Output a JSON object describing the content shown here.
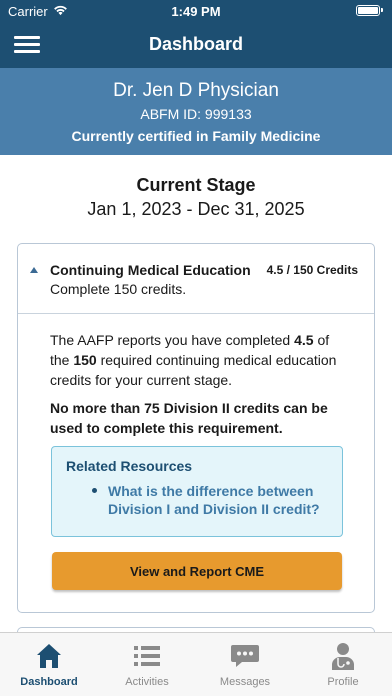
{
  "status_bar": {
    "carrier": "Carrier",
    "time": "1:49 PM"
  },
  "nav": {
    "title": "Dashboard"
  },
  "profile": {
    "name": "Dr. Jen D Physician",
    "abfm_id": "ABFM ID: 999133",
    "certification": "Currently certified in Family Medicine"
  },
  "stage": {
    "title": "Current Stage",
    "dates": "Jan 1, 2023 - Dec 31, 2025"
  },
  "cme_card": {
    "title": "Continuing Medical Education",
    "credits": "4.5 / 150 Credits",
    "subtitle": "Complete 150 credits.",
    "body_prefix": "The AAFP reports you have completed ",
    "completed": "4.5",
    "body_mid": " of the ",
    "required": "150",
    "body_suffix": " required continuing medical education credits for your current stage.",
    "note": "No more than 75 Division II credits can be used to complete this requirement.",
    "resources_title": "Related Resources",
    "resources": [
      "What is the difference between Division I and Division II credit?"
    ],
    "button_label": "View and Report CME"
  },
  "tabs": [
    {
      "label": "Dashboard",
      "icon": "home-icon",
      "active": true
    },
    {
      "label": "Activities",
      "icon": "list-icon",
      "active": false
    },
    {
      "label": "Messages",
      "icon": "chat-icon",
      "active": false
    },
    {
      "label": "Profile",
      "icon": "doctor-icon",
      "active": false
    }
  ],
  "colors": {
    "nav": "#1d4f72",
    "banner": "#4a7fab",
    "accent_button": "#e79a2e",
    "link": "#3f7aa6",
    "resource_bg": "#e4f5fa"
  }
}
